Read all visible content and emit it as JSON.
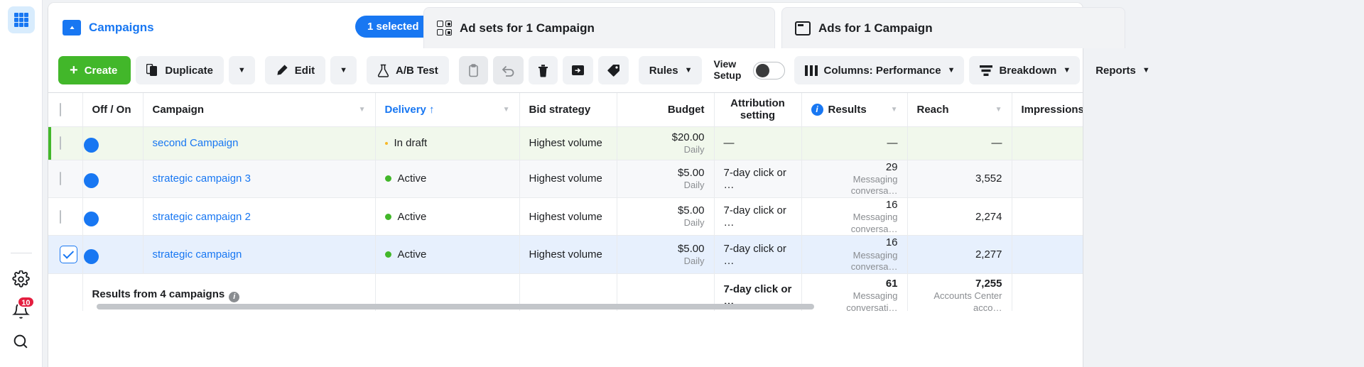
{
  "rail": {
    "logo_icon": "grid-logo-icon",
    "items": [
      {
        "icon": "gear-icon",
        "name": "settings"
      },
      {
        "icon": "bell-icon",
        "name": "notifications",
        "badge": "10"
      },
      {
        "icon": "search-icon",
        "name": "search"
      }
    ]
  },
  "tabs": [
    {
      "label": "Campaigns",
      "icon": "folder-icon",
      "active": true
    },
    {
      "label": "Ad sets for 1 Campaign",
      "icon": "grid-icon",
      "active": false
    },
    {
      "label": "Ads for 1 Campaign",
      "icon": "window-icon",
      "active": false
    }
  ],
  "selection_pill": {
    "label": "1 selected",
    "close_icon": "close-icon"
  },
  "toolbar": {
    "create_label": "Create",
    "duplicate_label": "Duplicate",
    "duplicate_caret": "▼",
    "edit_label": "Edit",
    "edit_caret": "▼",
    "abtest_label": "A/B Test",
    "copy_icon": "clipboard-icon",
    "undo_icon": "undo-icon",
    "delete_icon": "trash-icon",
    "export_icon": "export-icon",
    "tag_icon": "tag-icon",
    "rules_label": "Rules",
    "rules_caret": "▼",
    "view_setup_label": "View Setup",
    "view_setup_on": false,
    "columns_label": "Columns: Performance",
    "columns_caret": "▼",
    "breakdown_label": "Breakdown",
    "breakdown_caret": "▼",
    "reports_label": "Reports",
    "reports_caret": "▼"
  },
  "table": {
    "columns": [
      {
        "key": "check",
        "label": ""
      },
      {
        "key": "offon",
        "label": "Off / On"
      },
      {
        "key": "campaign",
        "label": "Campaign",
        "caret": true
      },
      {
        "key": "delivery",
        "label": "Delivery",
        "sort": "↑",
        "sorted": true,
        "caret": true
      },
      {
        "key": "bid",
        "label": "Bid strategy"
      },
      {
        "key": "budget",
        "label": "Budget"
      },
      {
        "key": "attribution",
        "label": "Attribution setting"
      },
      {
        "key": "results",
        "label": "Results",
        "info": true,
        "caret": true
      },
      {
        "key": "reach",
        "label": "Reach",
        "caret": true
      },
      {
        "key": "impressions",
        "label": "Impressions"
      }
    ],
    "rows": [
      {
        "checked": false,
        "toggle_on": true,
        "highlight": "new",
        "campaign": "second Campaign",
        "delivery": "In draft",
        "delivery_state": "draft",
        "bid": "Highest volume",
        "budget": "$20.00",
        "budget_sub": "Daily",
        "attribution": "—",
        "results": "—",
        "results_sub": "",
        "reach": "—",
        "impressions": ""
      },
      {
        "checked": false,
        "toggle_on": true,
        "highlight": "alt",
        "campaign": "strategic campaign 3",
        "delivery": "Active",
        "delivery_state": "active",
        "bid": "Highest volume",
        "budget": "$5.00",
        "budget_sub": "Daily",
        "attribution": "7-day click or …",
        "results": "29",
        "results_sub": "Messaging conversa…",
        "reach": "3,552",
        "impressions": ""
      },
      {
        "checked": false,
        "toggle_on": true,
        "highlight": "plain",
        "campaign": "strategic campaign 2",
        "delivery": "Active",
        "delivery_state": "active",
        "bid": "Highest volume",
        "budget": "$5.00",
        "budget_sub": "Daily",
        "attribution": "7-day click or …",
        "results": "16",
        "results_sub": "Messaging conversa…",
        "reach": "2,274",
        "impressions": ""
      },
      {
        "checked": true,
        "toggle_on": true,
        "highlight": "sel",
        "campaign": "strategic campaign",
        "delivery": "Active",
        "delivery_state": "active",
        "bid": "Highest volume",
        "budget": "$5.00",
        "budget_sub": "Daily",
        "attribution": "7-day click or …",
        "results": "16",
        "results_sub": "Messaging conversa…",
        "reach": "2,277",
        "impressions": ""
      }
    ],
    "footer": {
      "label": "Results from 4 campaigns",
      "info_icon": "info-icon",
      "attribution": "7-day click or …",
      "results": "61",
      "results_sub": "Messaging conversati…",
      "reach": "7,255",
      "reach_sub": "Accounts Center acco…"
    }
  },
  "colors": {
    "brand_blue": "#1877f2",
    "create_green": "#42b72a",
    "badge_red": "#e41e3f",
    "draft_amber": "#f7b928"
  }
}
